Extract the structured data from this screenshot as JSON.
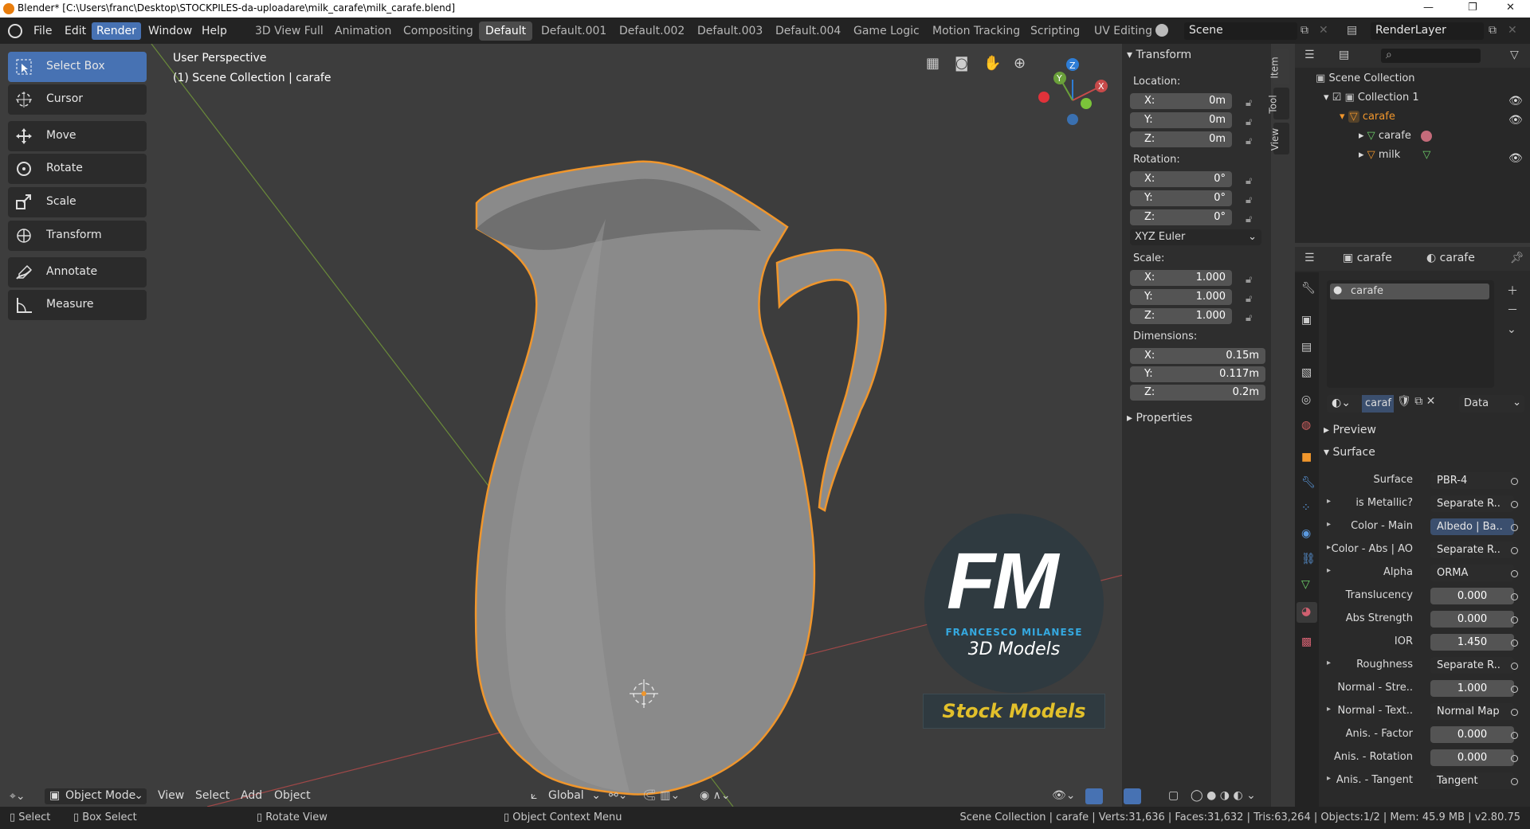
{
  "window": {
    "title": "Blender* [C:\\Users\\franc\\Desktop\\STOCKPILES-da-uploadare\\milk_carafe\\milk_carafe.blend]",
    "minimize": "—",
    "maximize": "❐",
    "close": "✕"
  },
  "menu": [
    "File",
    "Edit",
    "Render",
    "Window",
    "Help"
  ],
  "active_menu": "Render",
  "workspaces": [
    "3D View Full",
    "Animation",
    "Compositing",
    "Default",
    "Default.001",
    "Default.002",
    "Default.003",
    "Default.004",
    "Game Logic",
    "Motion Tracking",
    "Scripting",
    "UV Editing"
  ],
  "active_workspace": "Default",
  "scene": "Scene",
  "render_layer": "RenderLayer",
  "viewport": {
    "perspective": "User Perspective",
    "collection": "(1) Scene Collection | carafe"
  },
  "tools": [
    "Select Box",
    "Cursor",
    "Move",
    "Rotate",
    "Scale",
    "Transform",
    "Annotate",
    "Measure"
  ],
  "transform": {
    "header": "Transform",
    "location_label": "Location:",
    "location": {
      "x": "0m",
      "y": "0m",
      "z": "0m"
    },
    "rotation_label": "Rotation:",
    "rotation": {
      "x": "0°",
      "y": "0°",
      "z": "0°"
    },
    "rotation_mode": "XYZ Euler",
    "scale_label": "Scale:",
    "scale": {
      "x": "1.000",
      "y": "1.000",
      "z": "1.000"
    },
    "dimensions_label": "Dimensions:",
    "dimensions": {
      "x": "0.15m",
      "y": "0.117m",
      "z": "0.2m"
    },
    "properties_header": "Properties",
    "axis_x": "X:",
    "axis_y": "Y:",
    "axis_z": "Z:"
  },
  "sidebar_tabs": [
    "Item",
    "Tool",
    "View"
  ],
  "outliner": {
    "root": "Scene Collection",
    "collection": "Collection 1",
    "object": "carafe",
    "mesh": "carafe",
    "child": "milk"
  },
  "props": {
    "object_name": "carafe",
    "material_name": "carafe",
    "slot": "carafe",
    "material_field": "caraf",
    "data_select": "Data",
    "preview": "Preview",
    "surface_header": "Surface",
    "rows": [
      {
        "label": "Surface",
        "value": "PBR-4",
        "type": "link",
        "expand": false
      },
      {
        "label": "is Metallic?",
        "value": "Separate R..",
        "type": "link",
        "expand": true
      },
      {
        "label": "Color - Main",
        "value": "Albedo | Ba..",
        "type": "link sel",
        "expand": true
      },
      {
        "label": "Color - Abs | AO",
        "value": "Separate R..",
        "type": "link",
        "expand": true
      },
      {
        "label": "Alpha",
        "value": "ORMA",
        "type": "link",
        "expand": true
      },
      {
        "label": "Translucency",
        "value": "0.000",
        "type": "num",
        "expand": false
      },
      {
        "label": "Abs Strength",
        "value": "0.000",
        "type": "num",
        "expand": false
      },
      {
        "label": "IOR",
        "value": "1.450",
        "type": "num",
        "expand": false
      },
      {
        "label": "Roughness",
        "value": "Separate R..",
        "type": "link",
        "expand": true
      },
      {
        "label": "Normal - Stre..",
        "value": "1.000",
        "type": "num",
        "expand": false
      },
      {
        "label": "Normal - Text..",
        "value": "Normal Map",
        "type": "link",
        "expand": true
      },
      {
        "label": "Anis. - Factor",
        "value": "0.000",
        "type": "num",
        "expand": false
      },
      {
        "label": "Anis. - Rotation",
        "value": "0.000",
        "type": "num",
        "expand": false
      },
      {
        "label": "Anis. - Tangent",
        "value": "Tangent",
        "type": "link",
        "expand": true
      }
    ]
  },
  "header3d": {
    "mode": "Object Mode",
    "menus": [
      "View",
      "Select",
      "Add",
      "Object"
    ],
    "orientation": "Global"
  },
  "watermark": {
    "logo": "FM",
    "author": "FRANCESCO MILANESE",
    "subtitle": "3D Models",
    "badge": "Stock Models"
  },
  "statusbar": {
    "select": "Select",
    "box_select": "Box Select",
    "rotate_view": "Rotate View",
    "context_menu": "Object Context Menu",
    "stats": "Scene Collection | carafe | Verts:31,636 | Faces:31,632 | Tris:63,264 | Objects:1/2 | Mem: 45.9 MB | v2.80.75"
  },
  "colors": {
    "accent": "#4772b3",
    "selection_outline": "#f0962c",
    "background": "#3d3d3d"
  }
}
